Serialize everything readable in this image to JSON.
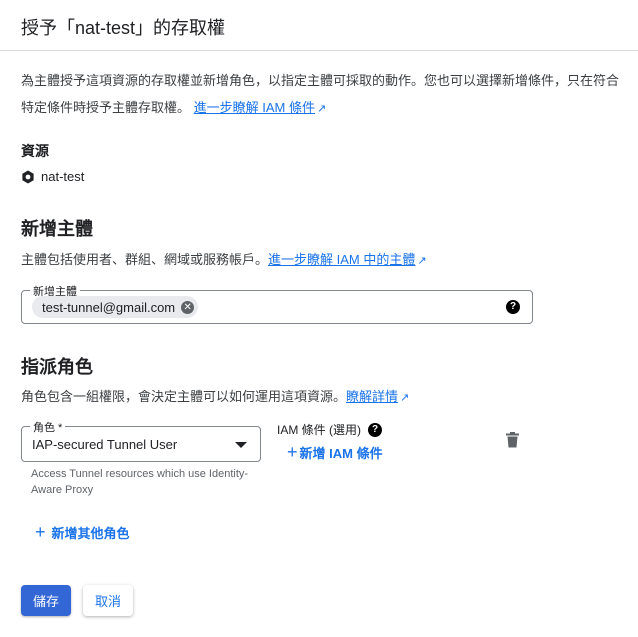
{
  "dialog": {
    "title": "授予「nat-test」的存取權"
  },
  "intro": {
    "text": "為主體授予這項資源的存取權並新增角色，以指定主體可採取的動作。您也可以選擇新增條件，只在符合特定條件時授予主體存取權。",
    "link": "進一步瞭解 IAM 條件"
  },
  "resource": {
    "heading": "資源",
    "name": "nat-test",
    "icon": "project-hexagon-icon"
  },
  "principals": {
    "heading": "新增主體",
    "description": "主體包括使用者、群組、網域或服務帳戶。",
    "link": "進一步瞭解 IAM 中的主體",
    "field_label": "新增主體",
    "chips": [
      "test-tunnel@gmail.com"
    ]
  },
  "roles": {
    "heading": "指派角色",
    "description": "角色包含一組權限，會決定主體可以如何運用這項資源。",
    "link": "瞭解詳情",
    "role_label": "角色 *",
    "role_value": "IAP-secured Tunnel User",
    "role_help": "Access Tunnel resources which use Identity-Aware Proxy",
    "condition_label": "IAM 條件 (選用)",
    "add_condition": "新增 IAM 條件",
    "add_role": "新增其他角色"
  },
  "actions": {
    "save": "儲存",
    "cancel": "取消"
  },
  "colors": {
    "primary": "#1a73e8",
    "save_bg": "#3367d6"
  }
}
